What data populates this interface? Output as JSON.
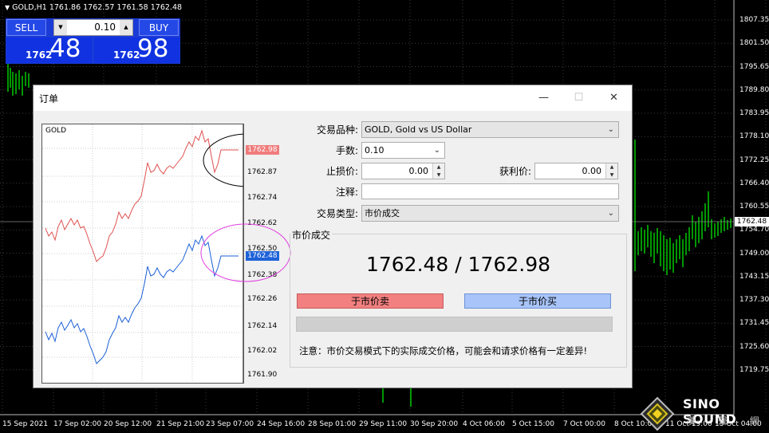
{
  "symbol_info": "GOLD,H1  1761.86 1762.57 1761.58 1762.48",
  "oneclick": {
    "sell_label": "SELL",
    "buy_label": "BUY",
    "lot": "0.10",
    "sell_small": "1762",
    "sell_big": "48",
    "buy_small": "1762",
    "buy_big": "98"
  },
  "y_axis": [
    "1807.35",
    "1801.50",
    "1795.65",
    "1789.80",
    "1783.95",
    "1778.10",
    "1772.25",
    "1766.40",
    "1760.55",
    "1754.70",
    "1749.00",
    "1743.15",
    "1737.30",
    "1731.45",
    "1725.60",
    "1719.75"
  ],
  "current_price": "1762.48",
  "x_axis": [
    "15 Sep 2021",
    "17 Sep 02:00",
    "20 Sep 12:00",
    "21 Sep 21:00",
    "23 Sep 07:00",
    "24 Sep 16:00",
    "28 Sep 01:00",
    "29 Sep 11:00",
    "30 Sep 20:00",
    "4 Oct 06:00",
    "5 Oct 15:00",
    "7 Oct 00:00",
    "8 Oct 10:00",
    "11 Oct 19:00",
    "13 Oct 04:00"
  ],
  "dialog": {
    "title": "订单",
    "minimize": "—",
    "maximize": "☐",
    "close": "✕",
    "mini_chart": {
      "symbol": "GOLD",
      "ask_tag": "1762.98",
      "bid_tag": "1762.48",
      "price_labels": [
        "1762.87",
        "1762.74",
        "1762.62",
        "1762.50",
        "1762.38",
        "1762.26",
        "1762.14",
        "1762.02",
        "1761.90"
      ]
    },
    "symbol_label": "交易品种:",
    "symbol_value": "GOLD, Gold vs US Dollar",
    "volume_label": "手数:",
    "volume_value": "0.10",
    "sl_label": "止损价:",
    "sl_value": "0.00",
    "tp_label": "获利价:",
    "tp_value": "0.00",
    "comment_label": "注释:",
    "comment_value": "",
    "type_label": "交易类型:",
    "type_value": "市价成交",
    "market_title": "市价成交",
    "big_price": "1762.48 / 1762.98",
    "sell_button": "于市价卖",
    "buy_button": "于市价买",
    "notice": "注意：市价交易模式下的实际成交价格，可能会和请求价格有一定差异!"
  },
  "logo": {
    "text": "SINO SOUND",
    "sub": "漢 聲 網"
  },
  "colors": {
    "bull": "#00c800",
    "sell_button": "#f28080",
    "buy_button": "#a8c4f8",
    "ask_line": "#e05050",
    "bid_line": "#1a5fd6"
  }
}
